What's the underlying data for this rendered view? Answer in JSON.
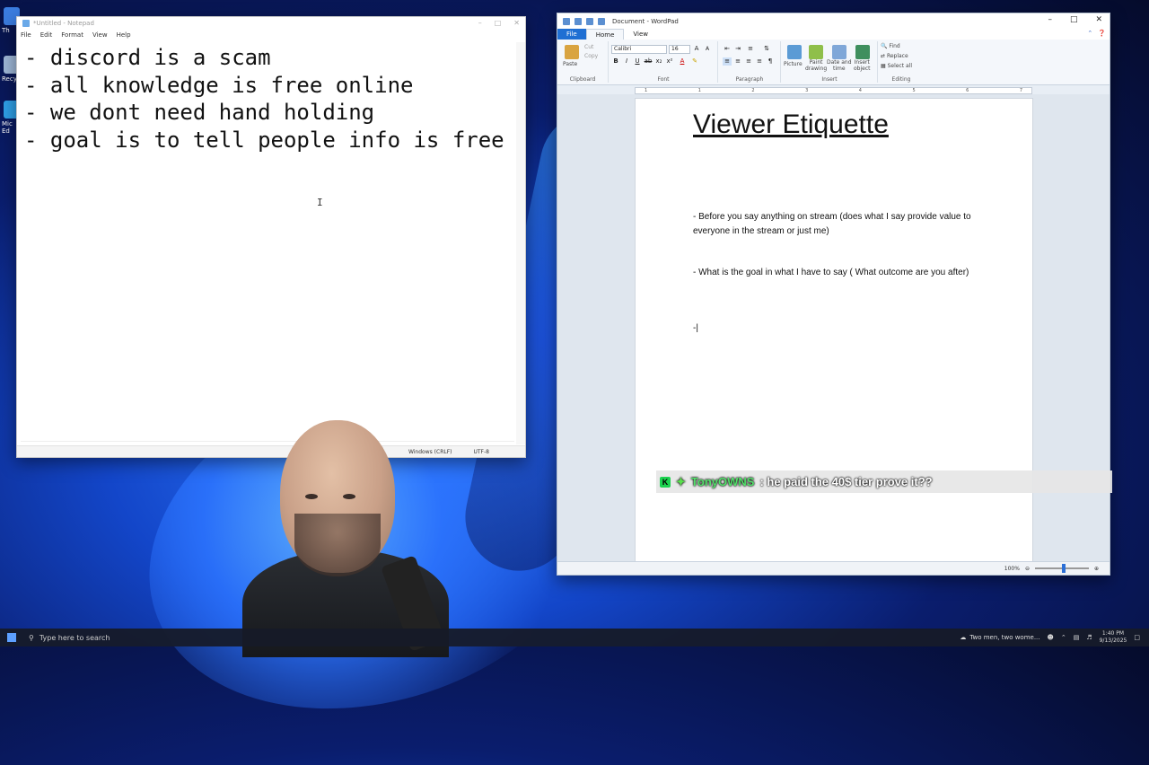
{
  "desktop": {
    "icons": [
      {
        "label": "Th"
      },
      {
        "label": "Recy"
      },
      {
        "label": "Mic\nEd"
      }
    ]
  },
  "notepad": {
    "title": "*Untitled - Notepad",
    "menu": [
      "File",
      "Edit",
      "Format",
      "View",
      "Help"
    ],
    "lines": [
      "- discord is a scam",
      "- all knowledge is free online",
      "- we dont need hand holding",
      "- goal is to tell people info is free"
    ],
    "status": {
      "encoding_eol": "Windows (CRLF)",
      "charset": "UTF-8"
    }
  },
  "wordpad": {
    "title": "Document - WordPad",
    "tabs": [
      "File",
      "Home",
      "View"
    ],
    "ribbon": {
      "clipboard": {
        "label": "Clipboard",
        "paste": "Paste",
        "cut": "Cut",
        "copy": "Copy"
      },
      "font": {
        "label": "Font",
        "font_name": "Calibri",
        "font_size": "16"
      },
      "paragraph": {
        "label": "Paragraph"
      },
      "insert": {
        "label": "Insert",
        "picture": "Picture",
        "paint_drawing": "Paint\ndrawing",
        "date_time": "Date and\ntime",
        "insert_object": "Insert\nobject"
      },
      "editing": {
        "label": "Editing",
        "find": "Find",
        "replace": "Replace",
        "select_all": "Select all"
      }
    },
    "ruler_ticks": [
      "1",
      "1",
      "2",
      "3",
      "4",
      "5",
      "6",
      "7"
    ],
    "document": {
      "title": "Viewer Etiquette",
      "para1": "- Before you say anything on stream (does what I say provide value to everyone in the stream or just me)",
      "para2": "- What is the goal in what I have to say ( What outcome are you after)",
      "para3": "-|"
    },
    "status": {
      "zoom": "100%"
    }
  },
  "chat": {
    "user": "TonyOWNS",
    "message": ": he paid the 40$ tier prove it??"
  },
  "taskbar": {
    "search_placeholder": "Type here to search",
    "news": "Two men, two wome...",
    "time": "1:40 PM",
    "date": "9/13/2025"
  },
  "colors": {
    "wordpad_file_tab": "#1f6fd3",
    "chat_username": "#53e06a",
    "taskbar_bg": "#161a28"
  }
}
